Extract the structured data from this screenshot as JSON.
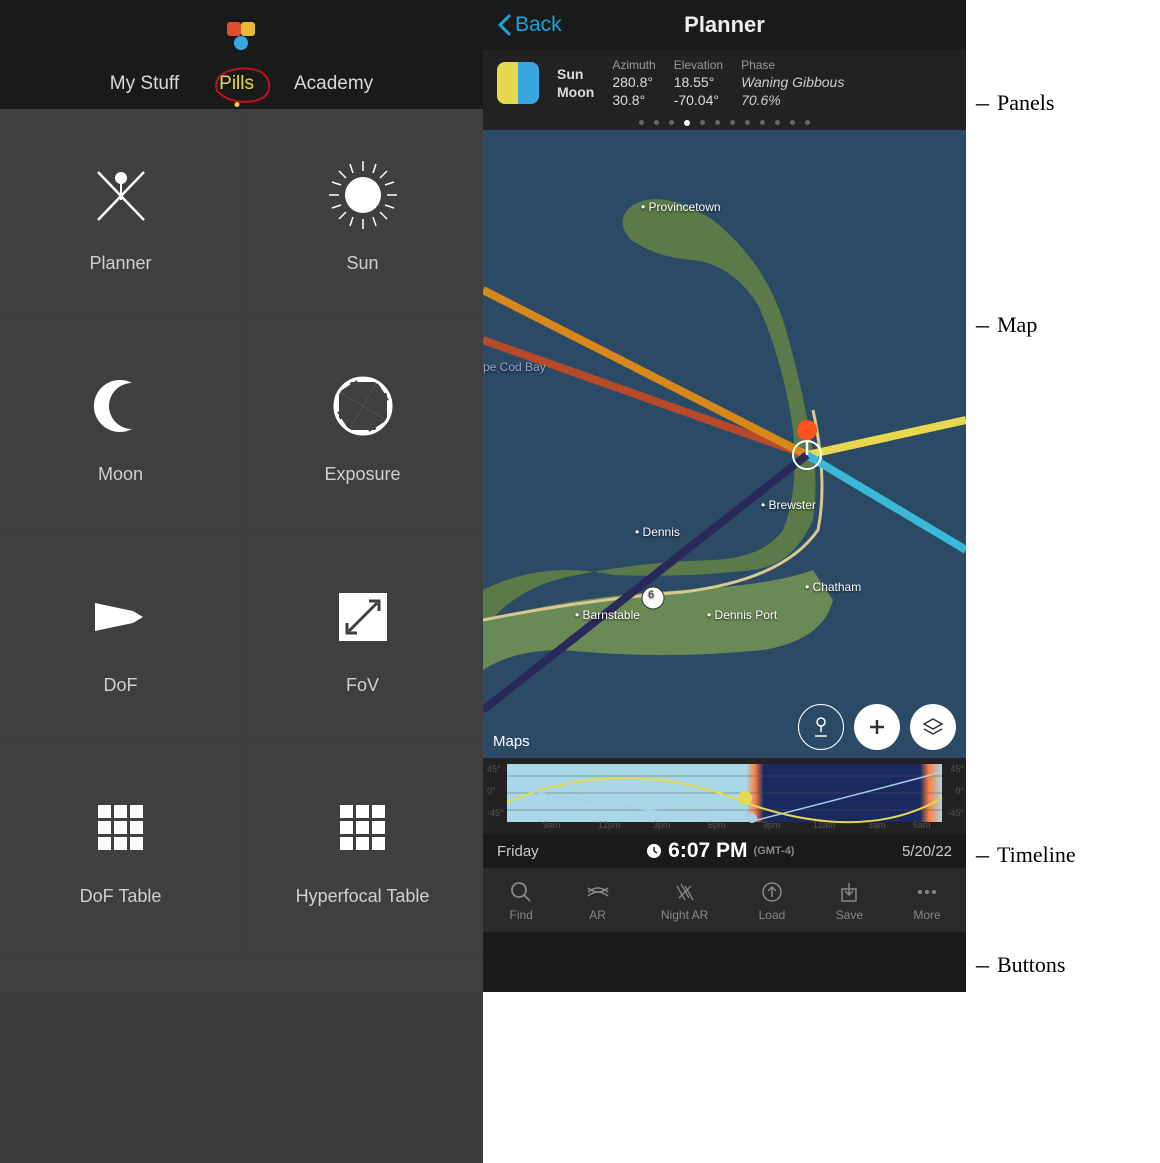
{
  "header": {
    "tabs": [
      "My Stuff",
      "Pills",
      "Academy"
    ],
    "active_tab_index": 1
  },
  "pills": [
    {
      "label": "Planner",
      "icon": "planner"
    },
    {
      "label": "Sun",
      "icon": "sun"
    },
    {
      "label": "Moon",
      "icon": "moon"
    },
    {
      "label": "Exposure",
      "icon": "aperture"
    },
    {
      "label": "DoF",
      "icon": "cone"
    },
    {
      "label": "FoV",
      "icon": "fov"
    },
    {
      "label": "DoF Table",
      "icon": "grid"
    },
    {
      "label": "Hyperfocal Table",
      "icon": "grid"
    }
  ],
  "planner": {
    "nav": {
      "back": "Back",
      "title": "Planner"
    },
    "panel": {
      "bodies": [
        "Sun",
        "Moon"
      ],
      "columns": {
        "azimuth": {
          "header": "Azimuth",
          "sun": "280.8°",
          "moon": "30.8°"
        },
        "elevation": {
          "header": "Elevation",
          "sun": "18.55°",
          "moon": "-70.04°"
        },
        "phase": {
          "header": "Phase",
          "v1": "Waning Gibbous",
          "v2": "70.6%"
        }
      },
      "page_dots": {
        "count": 12,
        "active": 3
      }
    },
    "map": {
      "attribution": "Maps",
      "bay_label": "pe Cod Bay",
      "towns": [
        "Provincetown",
        "Brewster",
        "Dennis",
        "Chatham",
        "Dennis Port",
        "Barnstable"
      ],
      "route": "6"
    },
    "timeline": {
      "y_ticks": [
        "45°",
        "0°",
        "-45°"
      ],
      "x_ticks": [
        "9am",
        "12pm",
        "3pm",
        "6pm",
        "9pm",
        "12am",
        "3am",
        "6am"
      ]
    },
    "time_row": {
      "day": "Friday",
      "time": "6:07 PM",
      "tz": "(GMT-4)",
      "date": "5/20/22"
    },
    "bottom_buttons": [
      "Find",
      "AR",
      "Night AR",
      "Load",
      "Save",
      "More"
    ]
  },
  "annotations": {
    "panels": "Panels",
    "map": "Map",
    "timeline": "Timeline",
    "buttons": "Buttons"
  }
}
